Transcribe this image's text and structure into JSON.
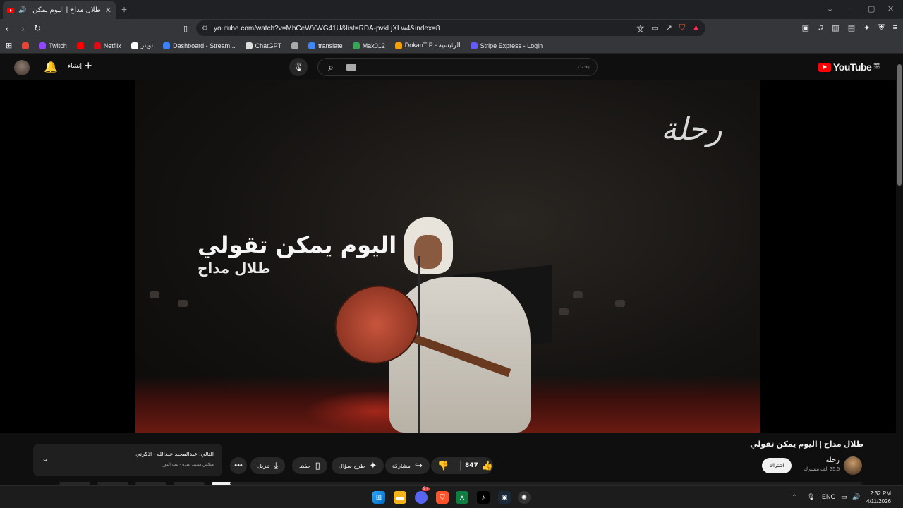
{
  "browser": {
    "tab_title": "طلال مداح | اليوم يمكن تقولي",
    "tab_close": "✕",
    "new_tab": "+",
    "url": "youtube.com/watch?v=MbCeWYWG41U&list=RDA-pvkLjXLw4&index=8"
  },
  "bookmarks": [
    {
      "label": "",
      "icon": "gmail-icon",
      "color": "#ea4335"
    },
    {
      "label": "Twitch",
      "icon": "twitch-icon",
      "color": "#9146ff"
    },
    {
      "label": "",
      "icon": "youtube-icon",
      "color": "#ff0000"
    },
    {
      "label": "Netflix",
      "icon": "netflix-icon",
      "color": "#e50914"
    },
    {
      "label": "تويتر",
      "icon": "x-icon",
      "color": "#ffffff"
    },
    {
      "label": "Dashboard - Stream...",
      "icon": "stream-icon",
      "color": "#3b82f6"
    },
    {
      "label": "ChatGPT",
      "icon": "chatgpt-icon",
      "color": "#dddddd"
    },
    {
      "label": "",
      "icon": "globe-icon",
      "color": "#aaaaaa"
    },
    {
      "label": "translate",
      "icon": "translate-icon",
      "color": "#4285f4"
    },
    {
      "label": "Max012",
      "icon": "max-icon",
      "color": "#34a853"
    },
    {
      "label": "DokanTIP - الرئيسية",
      "icon": "dokan-icon",
      "color": "#f59e0b"
    },
    {
      "label": "Stripe Express - Login",
      "icon": "stripe-icon",
      "color": "#635bff"
    }
  ],
  "youtube": {
    "create_label": "إنشاء",
    "search_placeholder": "بحث",
    "logo_text": "YouTube",
    "region": "SA",
    "video": {
      "calligraphy": "رحلة",
      "overlay_title": "اليوم يمكن تقولي",
      "overlay_artist": "طلال مداح"
    },
    "title": "طلال مداح | اليوم يمكن تقولي",
    "channel": {
      "name": "رحلة",
      "subscribers": "35.5 ألف مشترك",
      "subscribe_label": "اشتراك"
    },
    "actions": {
      "likes": "847",
      "share": "مشاركة",
      "ask": "طرح سؤال",
      "save": "حفظ",
      "download": "تنزيل",
      "more": "•••"
    },
    "next": {
      "line1": "التالي: عبدالمجيد عبدالله - اذكرني",
      "line2": "ميكس محمد عبده - بنت النور"
    }
  },
  "taskbar": {
    "language": "ENG",
    "time": "2:32 PM",
    "date": "4/11/2026",
    "discord_badge": "9+"
  }
}
